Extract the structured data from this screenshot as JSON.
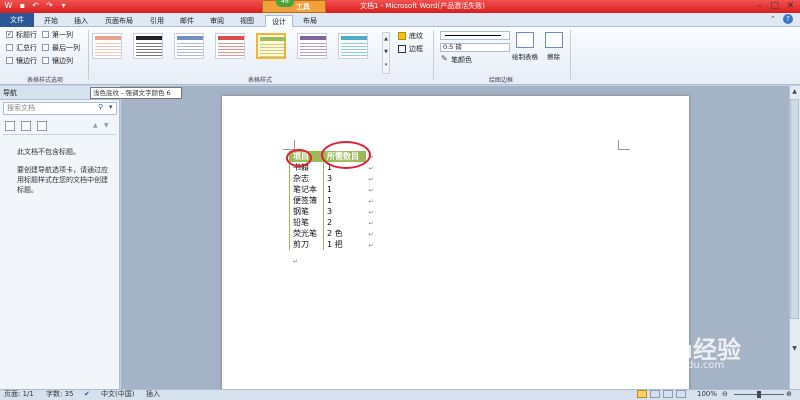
{
  "window": {
    "title": "文档1 - Microsoft Word(产品激活失败)",
    "context_tab_group": "工具",
    "context_badge": "46"
  },
  "tabs": [
    "文件",
    "开始",
    "插入",
    "页面布局",
    "引用",
    "邮件",
    "审阅",
    "视图",
    "设计",
    "布局"
  ],
  "active_tab": "设计",
  "ribbon": {
    "table_style_options": {
      "label": "表格样式选项",
      "options": [
        {
          "label": "标题行",
          "checked": true
        },
        {
          "label": "第一列",
          "checked": false
        },
        {
          "label": "汇总行",
          "checked": false
        },
        {
          "label": "最后一列",
          "checked": false
        },
        {
          "label": "镶边行",
          "checked": false
        },
        {
          "label": "镶边列",
          "checked": false
        }
      ]
    },
    "table_styles": {
      "label": "表格样式",
      "shading": "底纹",
      "borders": "边框",
      "thumb_colors": [
        "#e8a090",
        "#222222",
        "#6f8fc0",
        "#d94c4c",
        "#9bbb59",
        "#8064a2",
        "#4bacc6"
      ]
    },
    "draw_borders": {
      "label": "绘图边框",
      "pen_weight": "0.5 磅",
      "pen_color": "笔颜色",
      "draw_table": "绘制表格",
      "eraser": "擦除"
    }
  },
  "tooltip": "浅色底纹 - 强调文字颜色 6",
  "nav_pane": {
    "title": "导航",
    "search_placeholder": "搜索文档",
    "message1": "此文档不包含标题。",
    "message2": "要创建导航选项卡，请通过应用标题样式在您的文档中创建标题。"
  },
  "document": {
    "table": {
      "headers": [
        "项目",
        "所需数目"
      ],
      "rows": [
        [
          "书籍",
          "1"
        ],
        [
          "杂志",
          "3"
        ],
        [
          "笔记本",
          "1"
        ],
        [
          "便签簿",
          "1"
        ],
        [
          "钢笔",
          "3"
        ],
        [
          "铅笔",
          "2"
        ],
        [
          "荧光笔",
          "2 色"
        ],
        [
          "剪刀",
          "1 把"
        ]
      ]
    }
  },
  "status_bar": {
    "page": "页面: 1/1",
    "words": "字数: 35",
    "language": "中文(中国)",
    "mode": "插入",
    "zoom": "100%"
  },
  "watermark": {
    "logo": "Baidu经验",
    "url": "jingyan.baidu.com"
  },
  "colors": {
    "title_bar": "#d81d1d",
    "file_tab": "#2b5797",
    "table_header": "#9bbb59",
    "highlight_circle": "#e0203a"
  }
}
